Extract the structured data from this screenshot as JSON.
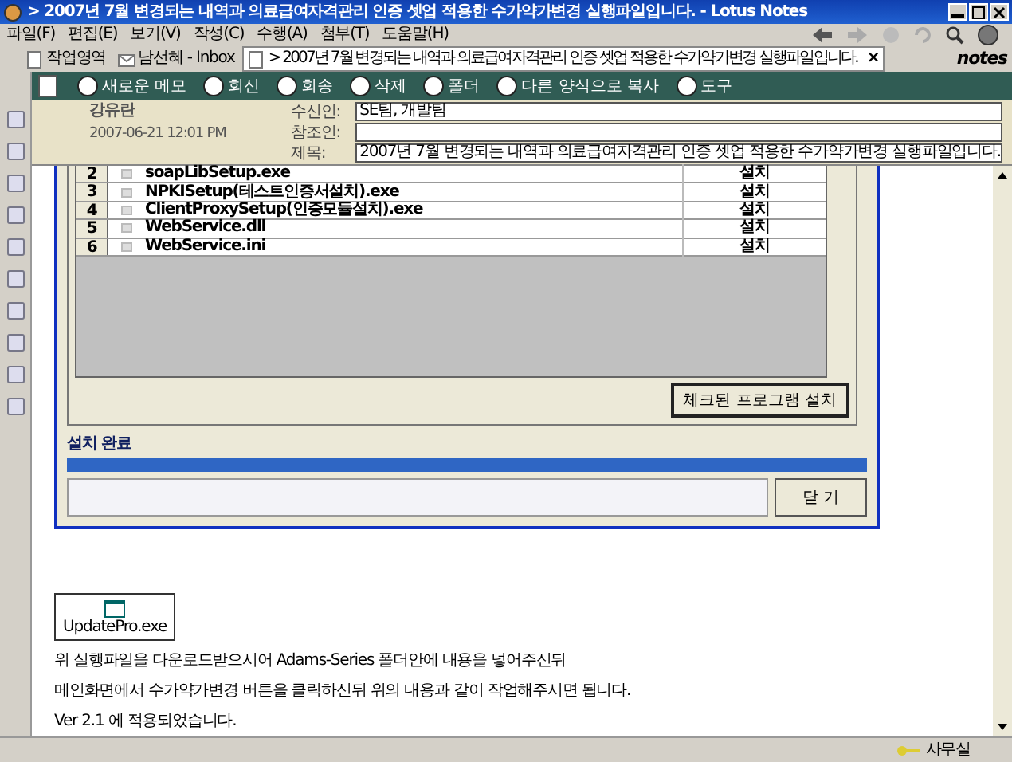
{
  "window": {
    "title": "> 2007년 7월 변경되는 내역과 의료급여자격관리 인증 셋업 적용한 수가약가변경 실행파일입니다.  - Lotus Notes"
  },
  "menu": [
    "파일(F)",
    "편집(E)",
    "보기(V)",
    "작성(C)",
    "수행(A)",
    "첨부(T)",
    "도움말(H)"
  ],
  "tabs": [
    {
      "label": "작업영역",
      "selected": false
    },
    {
      "label": "남선혜 - Inbox",
      "selected": false
    },
    {
      "label": "> 2007년 7월 변경되는 내역과 의료급여자격관리 인증 셋업 적용한 수가약가변경 실행파일입니다.",
      "selected": true,
      "close": "×"
    }
  ],
  "brand": "notes",
  "actions": [
    "새로운 메모",
    "회신",
    "회송",
    "삭제",
    "폴더",
    "다른 양식으로 복사",
    "도구"
  ],
  "header": {
    "sender": "강유란",
    "date": "2007-06-21 12:01 PM",
    "fields": [
      {
        "label": "수신인:",
        "value": "SE팀, 개발팀"
      },
      {
        "label": "참조인:"
      },
      {
        "label": "제목:",
        "value": "2007년 7월 변경되는 내역과 의료급여자격관리 인증 셋업 적용한 수가약가변경 실행파일입니다."
      }
    ]
  },
  "install_list": [
    {
      "number": "2",
      "name": "soapLibSetup.exe",
      "checked": false,
      "action": "설치"
    },
    {
      "number": "3",
      "name": "NPKISetup(테스트인증서설치).exe",
      "checked": false,
      "action": "설치"
    },
    {
      "number": "4",
      "name": "ClientProxySetup(인증모듈설치).exe",
      "checked": false,
      "action": "설치"
    },
    {
      "number": "5",
      "name": "WebService.dll",
      "checked": false,
      "action": "설치"
    },
    {
      "number": "6",
      "name": "WebService.ini",
      "checked": false,
      "action": "설치"
    }
  ],
  "install_button": "체크된 프로그램 설치",
  "progress": {
    "label": "설치 완료",
    "level": 1
  },
  "close_button": "닫 기",
  "attachment": "UpdatePro.exe",
  "paragraphs": [
    "위 실행파일을 다운로드받으시어 Adams-Series 폴더안에 내용을 넣어주신뒤",
    "메인화면에서 수가약가변경 버튼을 클릭하신뒤 위의 내용과 같이 작업해주시면 됩니다.",
    "Ver 2.1 에 적용되었습니다."
  ],
  "status_bar": {
    "location": "사무실"
  }
}
